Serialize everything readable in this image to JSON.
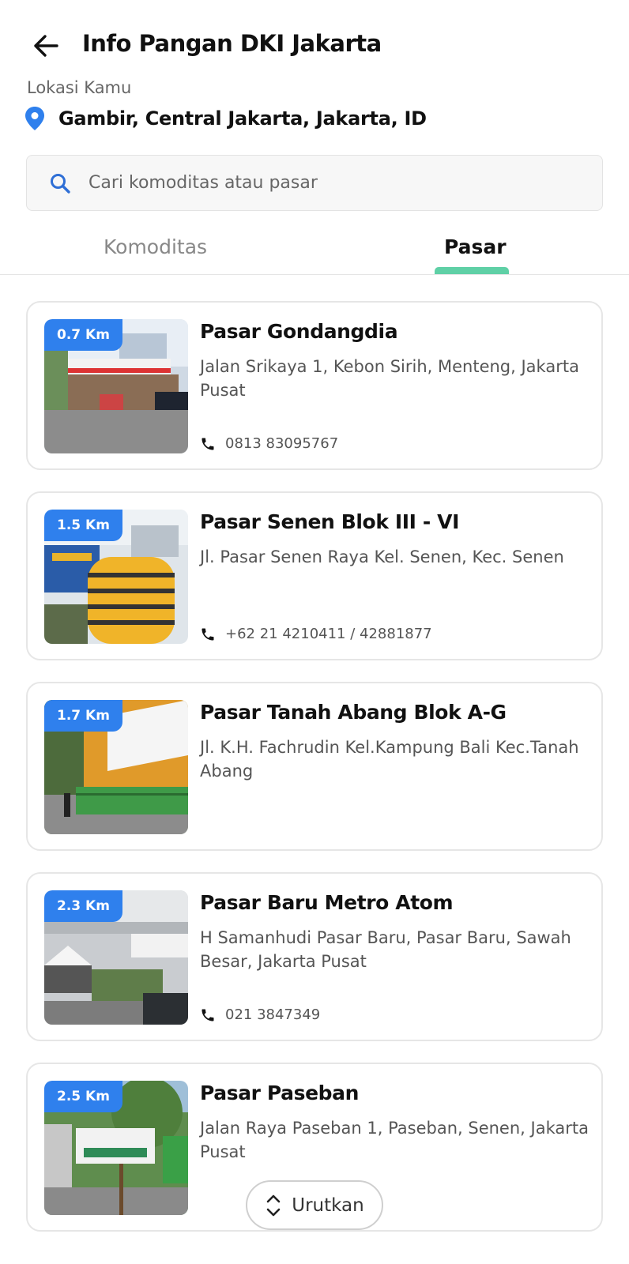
{
  "header": {
    "title": "Info Pangan DKI Jakarta"
  },
  "location": {
    "label": "Lokasi Kamu",
    "value": "Gambir, Central Jakarta, Jakarta, ID"
  },
  "search": {
    "placeholder": "Cari komoditas atau pasar"
  },
  "tabs": [
    {
      "label": "Komoditas",
      "active": false
    },
    {
      "label": "Pasar",
      "active": true
    }
  ],
  "colors": {
    "accent": "#2f80ed",
    "tab_indicator": "#5fd0a6",
    "pin": "#2f80ed"
  },
  "markets": [
    {
      "distance": "0.7 Km",
      "name": "Pasar Gondangdia",
      "address": "Jalan Srikaya 1, Kebon Sirih, Menteng, Jakarta Pusat",
      "phone": "0813 83095767"
    },
    {
      "distance": "1.5 Km",
      "name": "Pasar Senen Blok III - VI",
      "address": "Jl. Pasar Senen Raya Kel. Senen, Kec. Senen",
      "phone": "+62 21 4210411 / 42881877"
    },
    {
      "distance": "1.7 Km",
      "name": "Pasar Tanah Abang Blok A-G",
      "address": "Jl. K.H. Fachrudin Kel.Kampung Bali Kec.Tanah Abang",
      "phone": ""
    },
    {
      "distance": "2.3 Km",
      "name": "Pasar Baru Metro Atom",
      "address": "H Samanhudi Pasar Baru, Pasar Baru, Sawah Besar, Jakarta Pusat",
      "phone": "021 3847349"
    },
    {
      "distance": "2.5 Km",
      "name": "Pasar Paseban",
      "address": "Jalan Raya Paseban 1, Paseban, Senen, Jakarta Pusat",
      "phone": ""
    }
  ],
  "sort": {
    "label": "Urutkan"
  }
}
